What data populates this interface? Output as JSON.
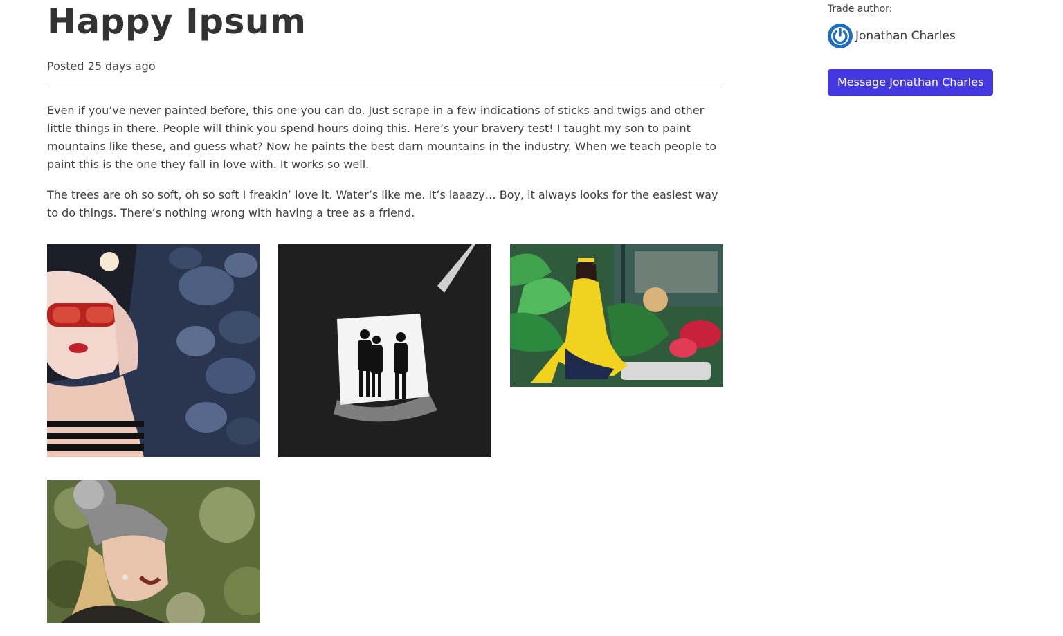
{
  "post": {
    "title": "Happy Ipsum",
    "posted": "Posted 25 days ago",
    "paragraphs": [
      "Even if you’ve never painted before, this one you can do. Just scrape in a few indications of sticks and twigs and other little things in there. People will think you spend hours doing this. Here’s your bravery test! I taught my son to paint mountains like these, and guess what? Now he paints the best darn mountains in the industry. When we teach people to paint this is the one they fall in love with. It works so well.",
      "The trees are oh so soft, oh so soft I freakin’ love it. Water’s like me. It’s laaazy… Boy, it always looks for the easiest way to do things. There’s nothing wrong with having a tree as a friend."
    ],
    "photos": [
      {
        "name": "photo-woman-sunglasses-stones"
      },
      {
        "name": "photo-tunnel-silhouettes"
      },
      {
        "name": "photo-woman-yellow-dress"
      },
      {
        "name": "photo-woman-knit-hat"
      }
    ]
  },
  "sidebar": {
    "author_label": "Trade author:",
    "author_name": "Jonathan Charles",
    "avatar_icon": "power-icon",
    "message_button": "Message Jonathan Charles",
    "accent": "#4338e0"
  }
}
